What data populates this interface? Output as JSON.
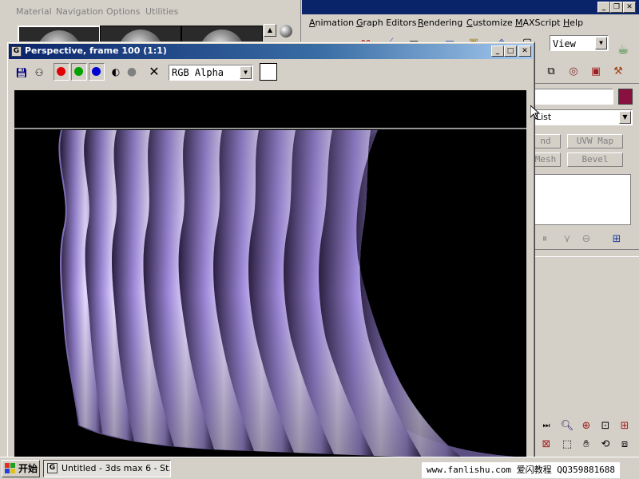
{
  "material_editor": {
    "menu": [
      "Material",
      "Navigation",
      "Options",
      "Utilities"
    ]
  },
  "max_window": {
    "menu": [
      "Animation",
      "Graph Editors",
      "Rendering",
      "Customize",
      "MAXScript",
      "Help"
    ],
    "view_dropdown": "View",
    "modifier_list": "List",
    "buttons": [
      "nd",
      "UVW Map",
      "Mesh",
      "Bevel"
    ]
  },
  "render_window": {
    "title": "Perspective, frame 100 (1:1)",
    "channel": "RGB Alpha",
    "colors": {
      "red": "#e00000",
      "green": "#00a000",
      "blue": "#0000d0"
    }
  },
  "taskbar": {
    "start_label": "开始",
    "task_label": "Untitled - 3ds max 6 - St...",
    "watermark": "www.fanlishu.com 爱闪教程 QQ359881688"
  }
}
